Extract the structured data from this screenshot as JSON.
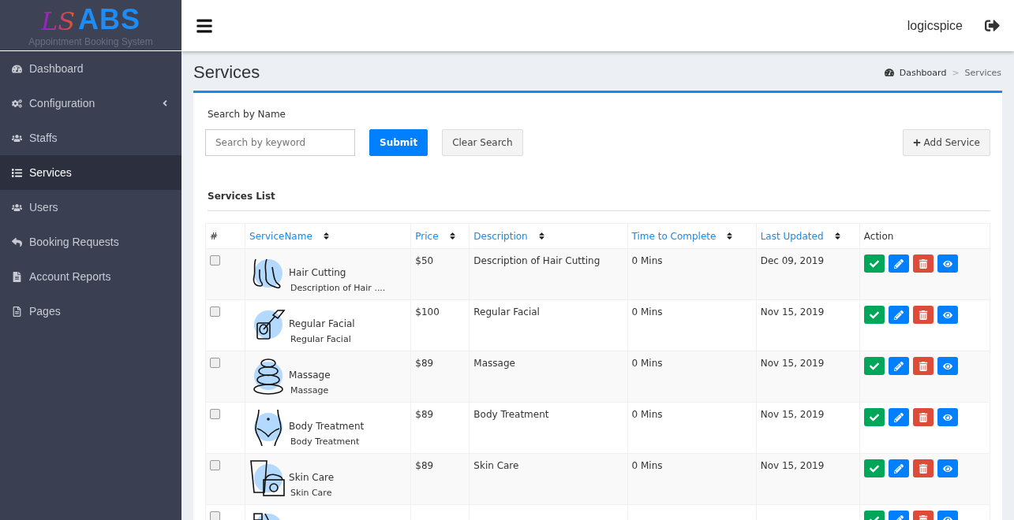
{
  "logo": {
    "mark": "LS",
    "name": "ABS",
    "tagline": "Appointment Booking System"
  },
  "sidebar": {
    "items": [
      {
        "label": "Dashboard",
        "kind": "link",
        "selected": false
      },
      {
        "label": "Configuration",
        "kind": "group",
        "selected": false,
        "expanded": false
      },
      {
        "label": "Staffs",
        "kind": "link",
        "selected": false
      },
      {
        "label": "Services",
        "kind": "link",
        "selected": true
      },
      {
        "label": "Users",
        "kind": "link",
        "selected": false
      },
      {
        "label": "Booking Requests",
        "kind": "link",
        "selected": false
      },
      {
        "label": "Account Reports",
        "kind": "link",
        "selected": false
      },
      {
        "label": "Pages",
        "kind": "link",
        "selected": false
      }
    ]
  },
  "topbar": {
    "user": "logicspice"
  },
  "page": {
    "title": "Services",
    "breadcrumb_separator": ">",
    "breadcrumb": [
      {
        "label": "Dashboard"
      },
      {
        "label": "Services"
      }
    ]
  },
  "search": {
    "label": "Search by Name",
    "placeholder": "Search by keyword",
    "submit": "Submit",
    "clear": "Clear Search",
    "add": "Add Service"
  },
  "table": {
    "title": "Services List",
    "columns": [
      {
        "label": "#",
        "sortable": false
      },
      {
        "label": "ServiceName",
        "sortable": true
      },
      {
        "label": "Price",
        "sortable": true
      },
      {
        "label": "Description",
        "sortable": true
      },
      {
        "label": "Time to Complete",
        "sortable": true
      },
      {
        "label": "Last Updated",
        "sortable": true
      },
      {
        "label": "Action",
        "sortable": false
      }
    ],
    "actions": [
      {
        "kind": "approve"
      },
      {
        "kind": "edit"
      },
      {
        "kind": "delete"
      },
      {
        "kind": "view"
      }
    ],
    "rows": [
      {
        "checked": false,
        "name": "Hair Cutting",
        "subtitle": "Description of Hair ....",
        "price": "$50",
        "description": "Description of Hair Cutting",
        "time": "0 Mins",
        "updated": "Dec 09, 2019"
      },
      {
        "checked": false,
        "name": "Regular Facial",
        "subtitle": "Regular Facial",
        "price": "$100",
        "description": "Regular Facial",
        "time": "0 Mins",
        "updated": "Nov 15, 2019"
      },
      {
        "checked": false,
        "name": "Massage",
        "subtitle": "Massage",
        "price": "$89",
        "description": "Massage",
        "time": "0 Mins",
        "updated": "Nov 15, 2019"
      },
      {
        "checked": false,
        "name": "Body Treatment",
        "subtitle": "Body Treatment",
        "price": "$89",
        "description": "Body Treatment",
        "time": "0 Mins",
        "updated": "Nov 15, 2019"
      },
      {
        "checked": false,
        "name": "Skin Care",
        "subtitle": "Skin Care",
        "price": "$89",
        "description": "Skin Care",
        "time": "0 Mins",
        "updated": "Nov 15, 2019"
      },
      {
        "checked": false
      }
    ]
  }
}
